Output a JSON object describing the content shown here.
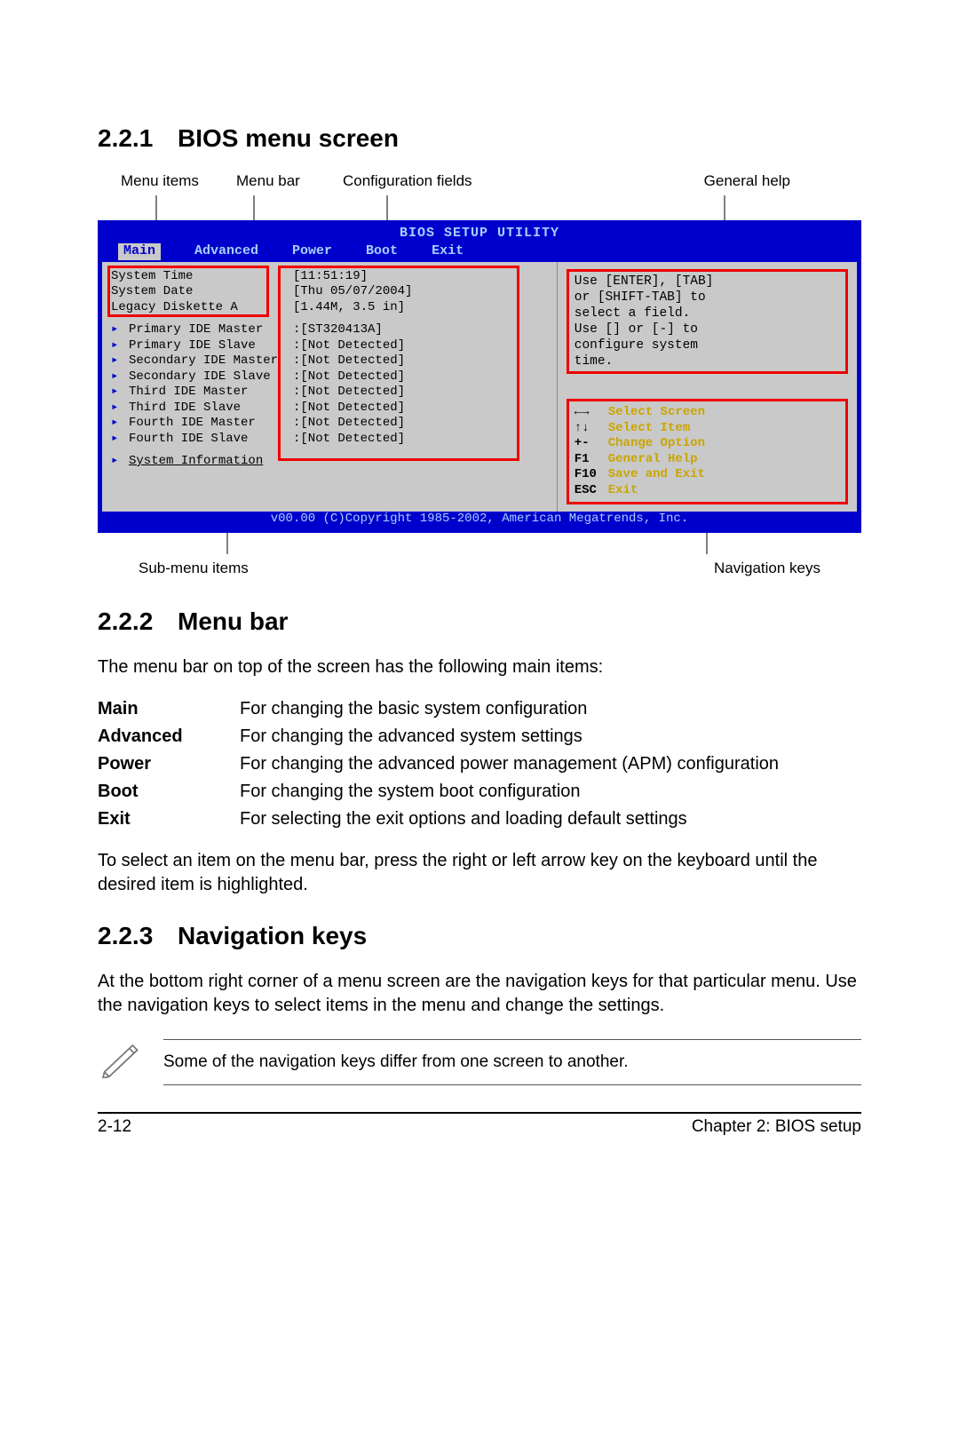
{
  "sections": {
    "s1": {
      "num": "2.2.1",
      "title": "BIOS menu screen"
    },
    "s2": {
      "num": "2.2.2",
      "title": "Menu bar"
    },
    "s3": {
      "num": "2.2.3",
      "title": "Navigation keys"
    }
  },
  "top_labels": {
    "l1": "Menu items",
    "l2": "Menu bar",
    "l3": "Configuration fields",
    "l4": "General help"
  },
  "bot_labels": {
    "l1": "Sub-menu items",
    "l2": "Navigation keys"
  },
  "bios": {
    "title": "BIOS SETUP UTILITY",
    "tabs": [
      "Main",
      "Advanced",
      "Power",
      "Boot",
      "Exit"
    ],
    "top_rows": [
      {
        "label": "System Time",
        "value": "[11:51:19]"
      },
      {
        "label": "System Date",
        "value": "[Thu 05/07/2004]"
      },
      {
        "label": "Legacy Diskette A",
        "value": "[1.44M, 3.5 in]"
      }
    ],
    "sub_rows": [
      {
        "label": "Primary IDE Master",
        "value": ":[ST320413A]"
      },
      {
        "label": "Primary IDE Slave",
        "value": ":[Not Detected]"
      },
      {
        "label": "Secondary IDE Master",
        "value": ":[Not Detected]"
      },
      {
        "label": "Secondary IDE Slave",
        "value": ":[Not Detected]"
      },
      {
        "label": "Third IDE Master",
        "value": ":[Not Detected]"
      },
      {
        "label": "Third IDE Slave",
        "value": ":[Not Detected]"
      },
      {
        "label": "Fourth IDE Master",
        "value": ":[Not Detected]"
      },
      {
        "label": "Fourth IDE Slave",
        "value": ":[Not Detected]"
      }
    ],
    "sysinfo": "System Information",
    "help": {
      "l1": "Use [ENTER], [TAB]",
      "l2": "or [SHIFT-TAB] to",
      "l3": "select a field.",
      "l4": "Use [] or [-] to",
      "l5": "configure system",
      "l6": "time."
    },
    "nav": [
      {
        "k": "←→",
        "t": "Select Screen"
      },
      {
        "k": "↑↓",
        "t": "Select Item"
      },
      {
        "k": "+-",
        "t": "Change Option"
      },
      {
        "k": "F1",
        "t": "General Help"
      },
      {
        "k": "F10",
        "t": "Save and Exit"
      },
      {
        "k": "ESC",
        "t": "Exit"
      }
    ],
    "footer": "v00.00 (C)Copyright 1985-2002, American Megatrends, Inc."
  },
  "menubar_intro": "The menu bar on top of the screen has the following main items:",
  "menubar_items": [
    {
      "k": "Main",
      "d": "For changing the basic system configuration"
    },
    {
      "k": "Advanced",
      "d": "For changing the advanced system settings"
    },
    {
      "k": "Power",
      "d": "For changing the advanced power management (APM) configuration"
    },
    {
      "k": "Boot",
      "d": "For changing the system boot configuration"
    },
    {
      "k": "Exit",
      "d": "For selecting the exit options and loading default settings"
    }
  ],
  "menubar_outro": "To select an item on the menu bar, press the right or left arrow key on the keyboard until the desired item is highlighted.",
  "navkeys_para": "At the bottom right corner of a menu screen are the navigation keys for that particular menu. Use the navigation keys to select items in the menu and change the settings.",
  "note": "Some of the navigation keys differ from one screen to another.",
  "footer": {
    "left": "2-12",
    "right": "Chapter 2: BIOS setup"
  }
}
